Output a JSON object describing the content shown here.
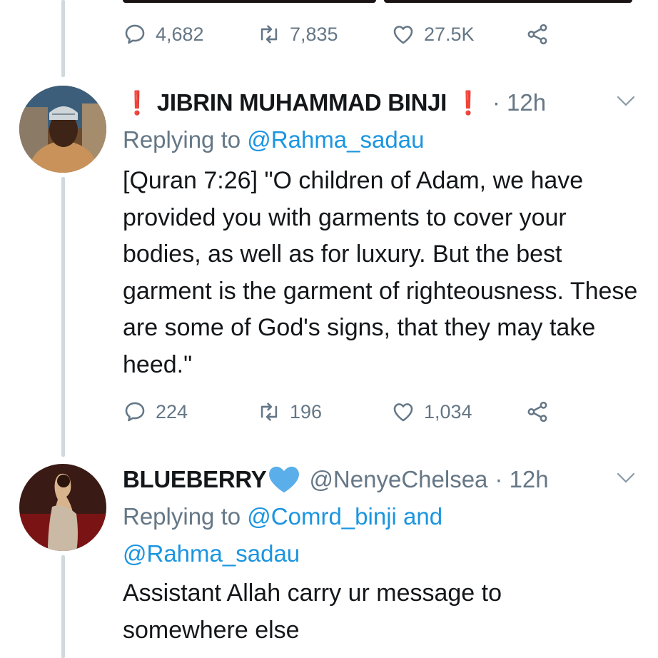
{
  "previous_tweet": {
    "actions": {
      "replies": "4,682",
      "retweets": "7,835",
      "likes": "27.5K"
    }
  },
  "tweet1": {
    "name_prefix": "❗",
    "name": "JIBRIN MUHAMMAD BINJI",
    "name_suffix": "❗",
    "time": "· 12h",
    "replying_label": "Replying to",
    "replying_to": "@Rahma_sadau",
    "text": "[Quran 7:26] \"O children of Adam, we have provided you with garments to cover your bodies, as well as for luxury. But the best garment is the garment of righteousness. These are some of God's signs, that they may take heed.\"",
    "actions": {
      "replies": "224",
      "retweets": "196",
      "likes": "1,034"
    }
  },
  "tweet2": {
    "name": "BLUEBERRY",
    "handle": "@NenyeChelsea",
    "time": "· 12h",
    "replying_label": "Replying to",
    "replying_to_1": "@Comrd_binji",
    "replying_and": "and",
    "replying_to_2": "@Rahma_sadau",
    "text": "Assistant Allah carry ur message to somewhere else"
  },
  "colors": {
    "accent": "#1b95e0",
    "muted": "#657786",
    "heart_emoji": "#5aaeea",
    "alert": "#e0182d"
  },
  "icons": [
    "reply-icon",
    "retweet-icon",
    "like-icon",
    "share-icon",
    "chevron-down-icon",
    "blue-heart-icon",
    "exclamation-icon"
  ]
}
